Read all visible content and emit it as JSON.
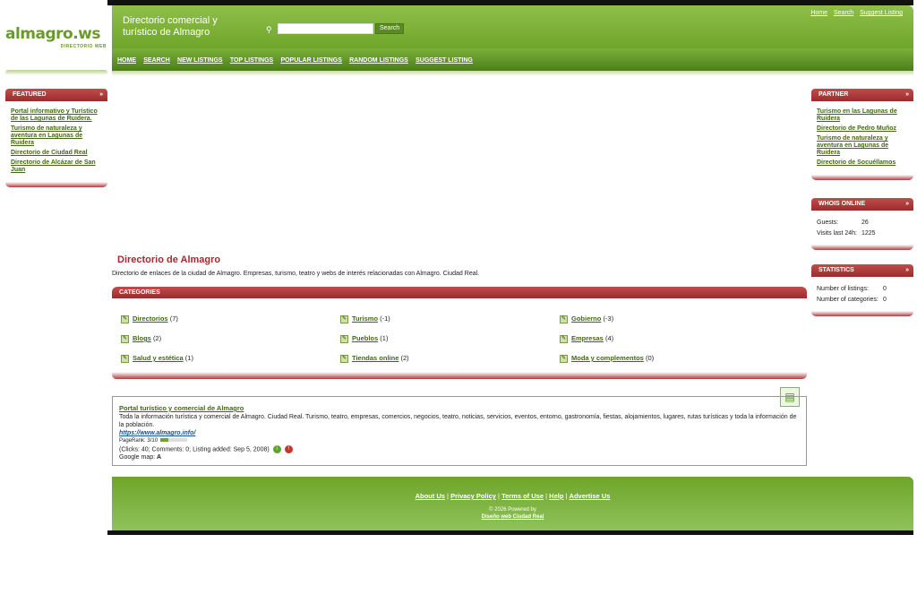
{
  "logo": {
    "text": "almagro.ws",
    "sub": "DIRECTORIO WEB"
  },
  "header": {
    "title": "Directorio comercial y turístico de Almagro",
    "search_button": "Search",
    "search_value": ""
  },
  "toplinks": [
    "Home",
    "Search",
    "Suggest Listing"
  ],
  "nav": [
    "HOME",
    "SEARCH",
    "NEW LISTINGS",
    "TOP LISTINGS",
    "POPULAR LISTINGS",
    "RANDOM LISTINGS",
    "SUGGEST LISTING"
  ],
  "featured": {
    "title": "FEATURED",
    "links": [
      "Portal informativo y Turístico de las Lagunas de Ruidera.",
      "Turismo de naturaleza y aventura en Lagunas de Ruidera",
      "Directorio de Ciudad Real",
      "Directorio de Alcázar de San Juan"
    ]
  },
  "partner": {
    "title": "PARTNER",
    "links": [
      "Turismo en las Lagunas de Ruidera",
      "Directorio de Pedro Muñoz",
      "Turismo de naturaleza y aventura en Lagunas de Ruidera",
      "Directorio de Socuéllamos"
    ]
  },
  "whois": {
    "title": "WHOIS ONLINE",
    "guests_label": "Guests:",
    "guests": "26",
    "visits_label": "Visits last 24h:",
    "visits": "1225"
  },
  "stats": {
    "title": "STATISTICS",
    "listings_label": "Number of listings:",
    "listings": "0",
    "categories_label": "Number of categories:",
    "categories": "0"
  },
  "main": {
    "title": "Directorio de Almagro",
    "desc": "Directorio de enlaces de la ciudad de Almagro. Empresas, turismo, teatro y webs de interés relacionadas con Almagro. Ciudad Real."
  },
  "categories": {
    "title": "CATEGORIES",
    "items": [
      {
        "name": "Directorios",
        "count": "(7)"
      },
      {
        "name": "Turismo",
        "count": "(-1)"
      },
      {
        "name": "Gobierno",
        "count": "(-3)"
      },
      {
        "name": "Blogs",
        "count": "(2)"
      },
      {
        "name": "Pueblos",
        "count": "(1)"
      },
      {
        "name": "Empresas",
        "count": "(4)"
      },
      {
        "name": "Salud y estética",
        "count": "(1)"
      },
      {
        "name": "Tiendas online",
        "count": "(2)"
      },
      {
        "name": "Moda y complementos",
        "count": "(0)"
      }
    ]
  },
  "listing": {
    "title": "Portal turístico y comercial de Almagro",
    "desc": "Toda la información turística y comercial de Almagro. Ciudad Real. Turismo, teatro, empresas, comercios, negocios, teatro, noticias, servicios, eventos, entorno, gastronomía, fiestas, alojamientos, lugares, rutas turísticas y toda la información de la población.",
    "url": "https://www.almagro.info/",
    "pagerank": "PageRank: 3/10",
    "pagerank_value": 0.3,
    "meta": "(Clicks: 40; Comments: 0; Listing added: Sep 5, 2008)",
    "map_label": "Google map:",
    "map_value": "A"
  },
  "footer": {
    "links": [
      "About Us",
      "Privacy Policy",
      "Terms of Use",
      "Help",
      "Advertise Us"
    ],
    "powered": "© 2026 Powered by",
    "powered_link": "Diseño web Ciudad Real"
  },
  "colors": {
    "green": "#6fa52a",
    "red": "#a52a2a"
  }
}
